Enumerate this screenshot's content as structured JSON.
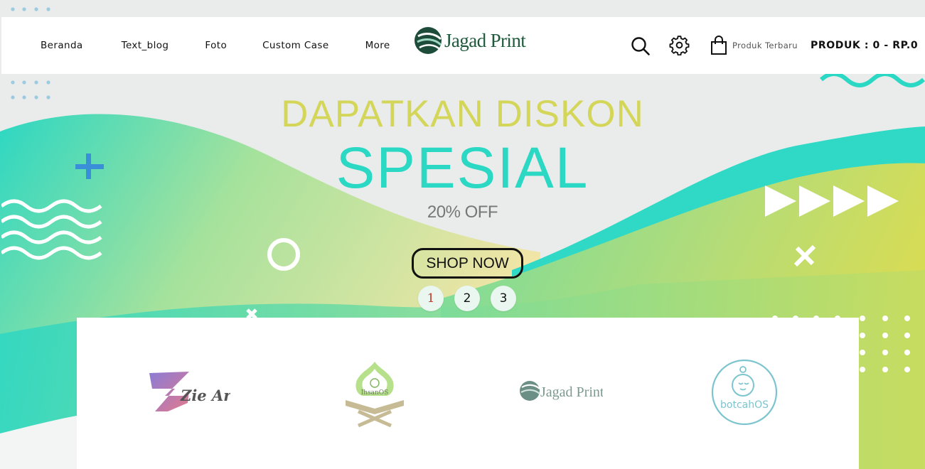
{
  "colors": {
    "accent_teal": "#2ad8c4",
    "accent_yellow": "#d4d65a",
    "logo_green": "#1f5a3c",
    "header_bg": "#ffffff"
  },
  "header": {
    "nav": [
      {
        "label": "Beranda"
      },
      {
        "label": "Text_blog"
      },
      {
        "label": "Foto"
      },
      {
        "label": "Custom Case"
      },
      {
        "label": "More"
      }
    ],
    "logo_text": "Jagad Print",
    "icons": [
      "search-icon",
      "gear-icon",
      "shopping-bag-icon"
    ],
    "cart_label": "Produk Terbaru",
    "cart_total": "PRODUK : 0 - RP.0"
  },
  "hero": {
    "line1": "DAPATKAN DISKON",
    "line2": "SPESIAL",
    "line3": "20% OFF",
    "cta": "SHOP NOW",
    "slides": [
      "1",
      "2",
      "3"
    ],
    "active_slide": 1
  },
  "brands": {
    "items": [
      {
        "name": "Zie Art"
      },
      {
        "name": "IhsanOS"
      },
      {
        "name": "Jagad Print"
      },
      {
        "name": "botcahOS"
      }
    ]
  }
}
